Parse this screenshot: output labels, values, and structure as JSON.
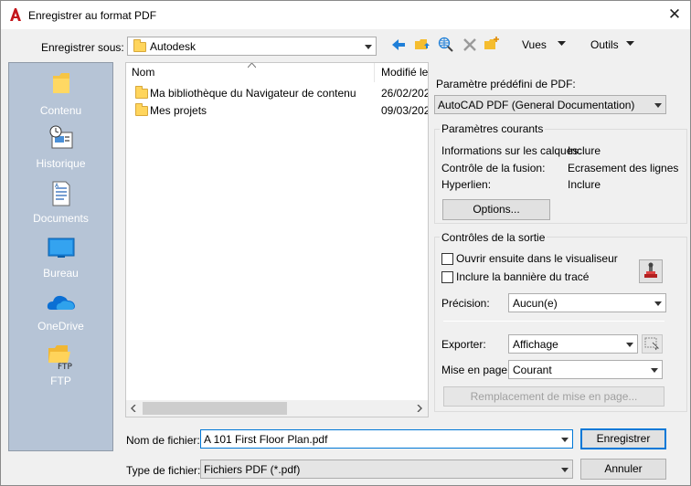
{
  "window": {
    "title": "Enregistrer au format PDF",
    "close_glyph": "✕"
  },
  "top": {
    "save_in_label": "Enregistrer sous:",
    "save_in_value": "Autodesk",
    "views_label": "Vues",
    "tools_label": "Outils"
  },
  "sidebar": {
    "items": [
      {
        "label": "Contenu",
        "icon": "folder-icon"
      },
      {
        "label": "Historique",
        "icon": "history-icon"
      },
      {
        "label": "Documents",
        "icon": "documents-icon"
      },
      {
        "label": "Bureau",
        "icon": "desktop-icon"
      },
      {
        "label": "OneDrive",
        "icon": "onedrive-icon"
      },
      {
        "label": "FTP",
        "icon": "ftp-folder-icon"
      }
    ]
  },
  "filelist": {
    "columns": [
      "Nom",
      "Modifié le"
    ],
    "rows": [
      {
        "name": "Ma bibliothèque du Navigateur de contenu",
        "modified": "26/02/202"
      },
      {
        "name": "Mes projets",
        "modified": "09/03/202"
      }
    ]
  },
  "pdf": {
    "preset_label": "Paramètre prédéfini de PDF:",
    "preset_value": "AutoCAD PDF (General Documentation)",
    "current": {
      "title": "Paramètres courants",
      "rows": [
        {
          "label": "Informations sur les calques:",
          "value": "Inclure"
        },
        {
          "label": "Contrôle de la fusion:",
          "value": "Ecrasement des lignes"
        },
        {
          "label": "Hyperlien:",
          "value": "Inclure"
        }
      ],
      "options_button": "Options..."
    },
    "output": {
      "title": "Contrôles de la sortie",
      "open_viewer": "Ouvrir ensuite dans le visualiseur",
      "include_banner": "Inclure la bannière du tracé",
      "precision_label": "Précision:",
      "precision_value": "Aucun(e)",
      "export_label": "Exporter:",
      "export_value": "Affichage",
      "page_setup_label": "Mise en page:",
      "page_setup_value": "Courant",
      "override_button": "Remplacement de mise en page..."
    }
  },
  "bottom": {
    "filename_label": "Nom de fichier:",
    "filename_value": "A 101 First Floor Plan.pdf",
    "filetype_label": "Type de fichier:",
    "filetype_value": "Fichiers PDF (*.pdf)",
    "save_button": "Enregistrer",
    "cancel_button": "Annuler"
  },
  "colors": {
    "sidebar_bg": "#b6c4d6",
    "accent": "#0078d7",
    "autocad_red": "#c4161c"
  }
}
